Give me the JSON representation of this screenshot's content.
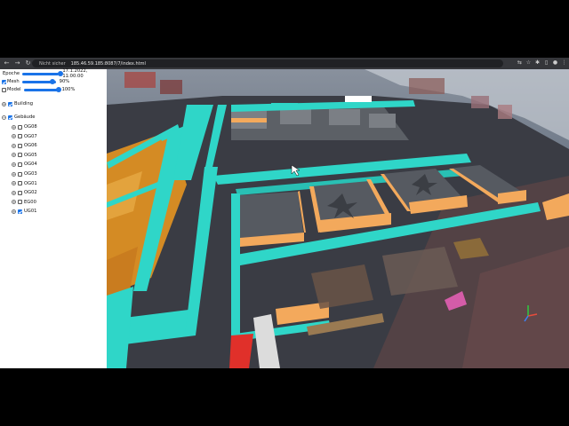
{
  "browser": {
    "security_label": "Nicht sicher",
    "url": "185.46.59.185:8087/7/index.html"
  },
  "panel": {
    "sliders": [
      {
        "label": "Epoche",
        "value_text": "17.1.2022, 11:00:00",
        "level": 0.98,
        "has_checkbox": false
      },
      {
        "label": "Mesh",
        "value_text": "90%",
        "level": 0.9,
        "has_checkbox": true,
        "checked": true
      },
      {
        "label": "Model",
        "value_text": "100%",
        "level": 1.0,
        "has_checkbox": true,
        "checked": false
      }
    ],
    "building": {
      "label": "Building",
      "checked": true
    },
    "group": {
      "label": "Gebäude",
      "checked": true
    },
    "floors": [
      {
        "label": "OG08",
        "checked": false
      },
      {
        "label": "OG07",
        "checked": false
      },
      {
        "label": "OG06",
        "checked": false
      },
      {
        "label": "OG05",
        "checked": false
      },
      {
        "label": "OG04",
        "checked": false
      },
      {
        "label": "OG03",
        "checked": false
      },
      {
        "label": "OG01",
        "checked": false
      },
      {
        "label": "OG02",
        "checked": false
      },
      {
        "label": "EG00",
        "checked": false
      },
      {
        "label": "UG01",
        "checked": true
      }
    ]
  },
  "colors": {
    "wall_cyan": "#2fd6c8",
    "room_orange": "#f3a95c",
    "slider_blue": "#1a73e8"
  }
}
